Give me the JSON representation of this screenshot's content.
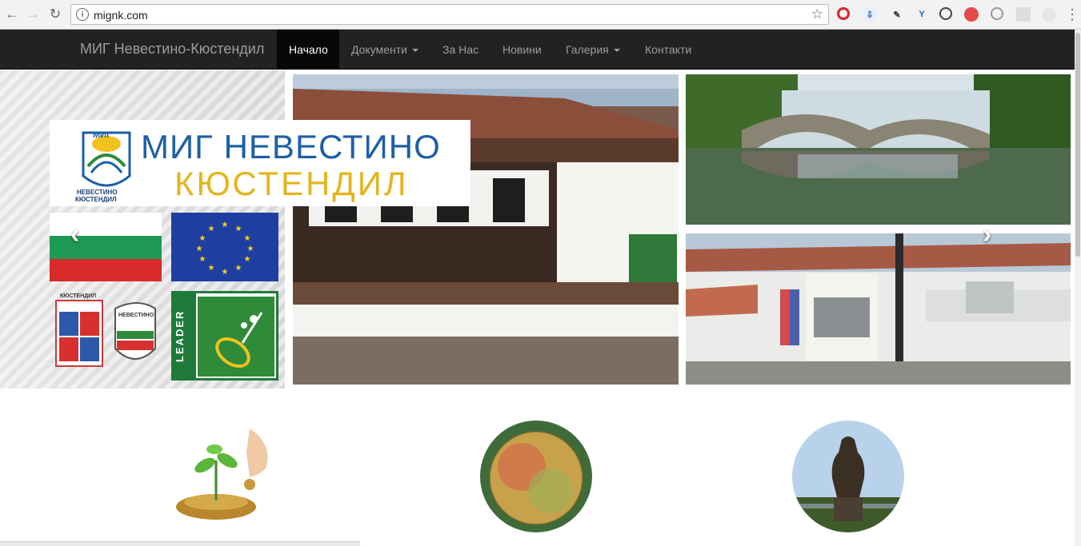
{
  "browser": {
    "url": "mignk.com",
    "back_icon": "←",
    "forward_icon": "→",
    "reload_icon": "↻",
    "star_icon": "☆"
  },
  "site": {
    "brand": "МИГ Невестино-Кюстендил",
    "nav": [
      {
        "label": "Начало",
        "active": true,
        "dropdown": false
      },
      {
        "label": "Документи",
        "active": false,
        "dropdown": true
      },
      {
        "label": "За Нас",
        "active": false,
        "dropdown": false
      },
      {
        "label": "Новини",
        "active": false,
        "dropdown": false
      },
      {
        "label": "Галерия",
        "active": false,
        "dropdown": true
      },
      {
        "label": "Контакти",
        "active": false,
        "dropdown": false
      }
    ]
  },
  "carousel": {
    "logo_title": "МИГ НЕВЕСТИНО",
    "logo_subtitle": "КЮСТЕНДИЛ",
    "badge_top": "МИГ",
    "badge_line1": "НЕВЕСТИНО",
    "badge_line2": "КЮСТЕНДИЛ",
    "crest_label": "КЮСТЕНДИЛ",
    "crest2_label": "НЕВЕСТИНО",
    "leader_label": "LEADER",
    "prev_icon": "‹",
    "next_icon": "›"
  },
  "colors": {
    "navbar": "#222222",
    "nav_active": "#080808",
    "logo_blue": "#1b5fa8",
    "logo_gold": "#e4b51b"
  }
}
